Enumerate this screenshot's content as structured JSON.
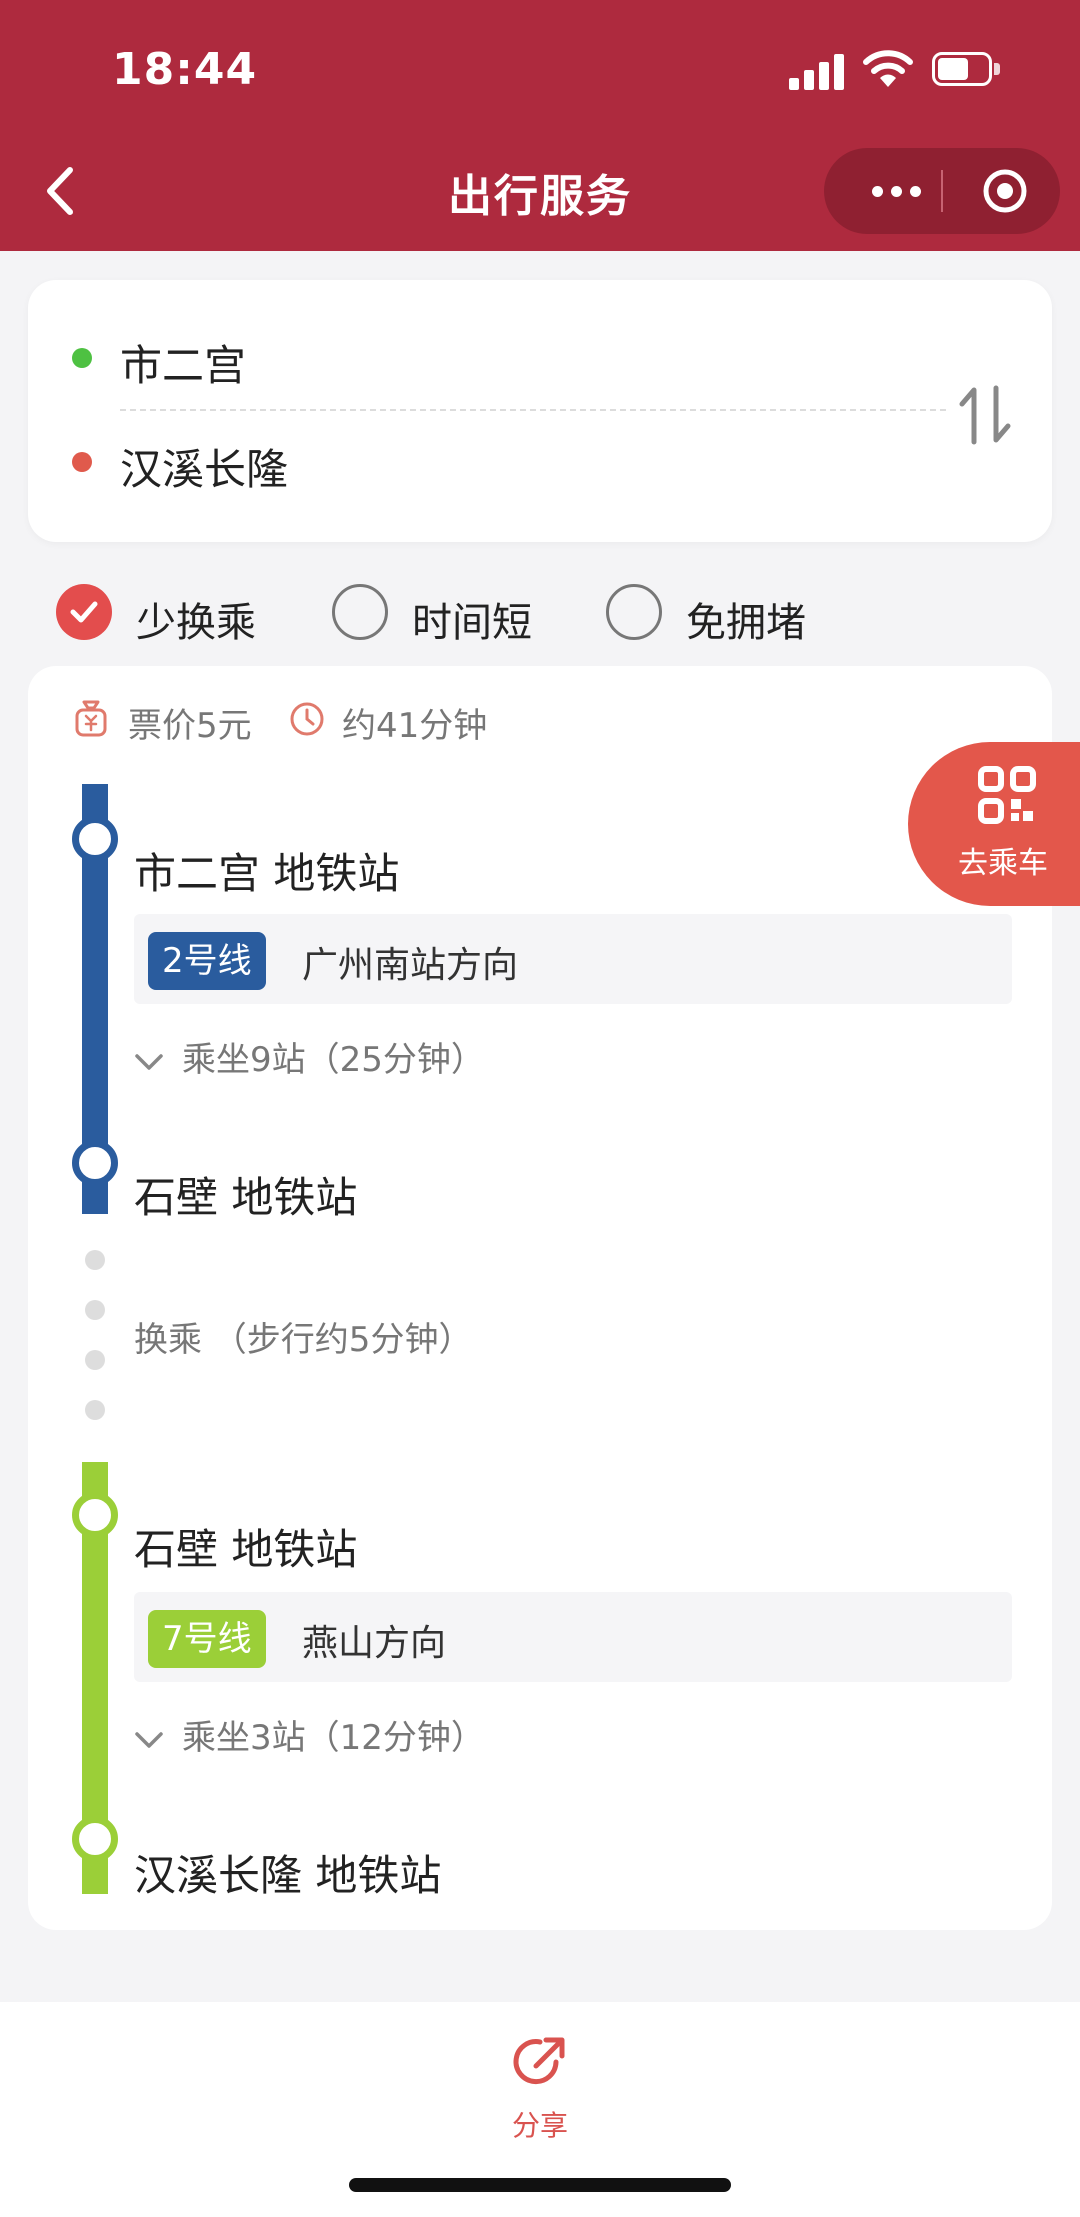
{
  "status_bar": {
    "time": "18:44"
  },
  "nav": {
    "title": "出行服务"
  },
  "route": {
    "from": "市二宫",
    "to": "汉溪长隆"
  },
  "options": [
    {
      "label": "少换乘",
      "selected": true
    },
    {
      "label": "时间短",
      "selected": false
    },
    {
      "label": "免拥堵",
      "selected": false
    }
  ],
  "summary": {
    "fare": "票价5元",
    "duration": "约41分钟"
  },
  "segments": [
    {
      "from_stop": "市二宫 地铁站",
      "line": "2号线",
      "direction": "广州南站方向",
      "ride": "乘坐9站（25分钟）",
      "to_stop": "石壁 地铁站",
      "color": "#2a5c9e"
    },
    {
      "from_stop": "石壁 地铁站",
      "line": "7号线",
      "direction": "燕山方向",
      "ride": "乘坐3站（12分钟）",
      "to_stop": "汉溪长隆 地铁站",
      "color": "#9bcf38"
    }
  ],
  "transfer": {
    "label": "换乘 （步行约5分钟）"
  },
  "board_button": {
    "label": "去乘车"
  },
  "bottom": {
    "share_label": "分享"
  },
  "colors": {
    "header": "#ae2a3e",
    "accent": "#e34d4d",
    "start_dot": "#4ec142",
    "end_dot": "#e05a4c"
  },
  "icons": [
    "back-icon",
    "more-icon",
    "close-circle-icon",
    "swap-icon",
    "check-icon",
    "ticket-icon",
    "clock-icon",
    "qr-code-icon",
    "share-icon"
  ]
}
